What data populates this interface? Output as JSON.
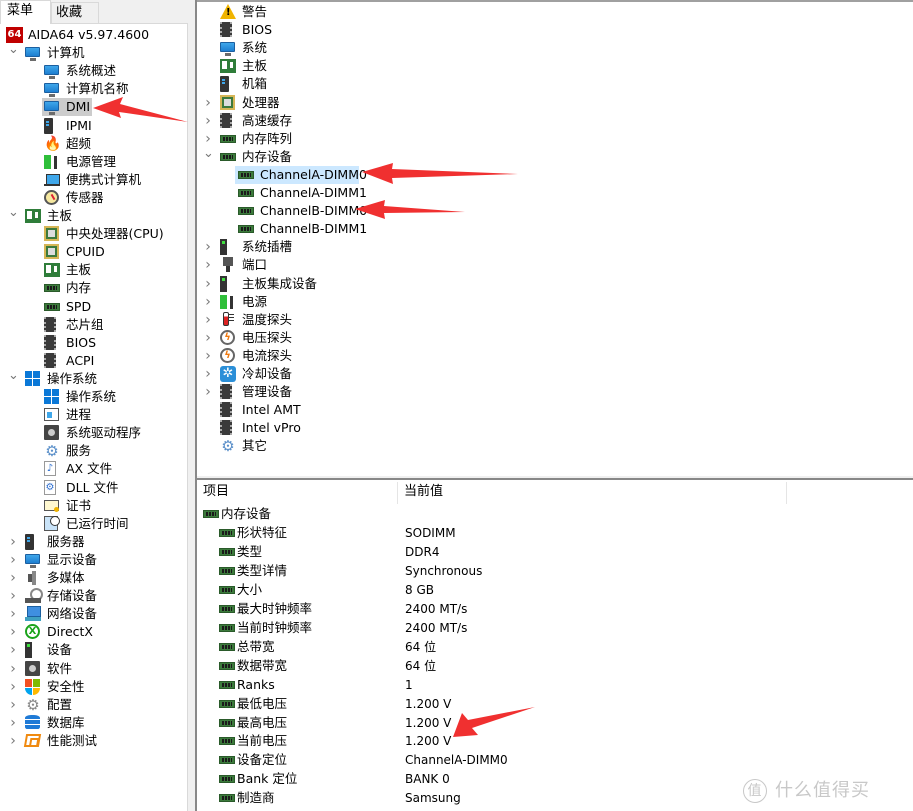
{
  "app": {
    "name": "AIDA64 v5.97.4600"
  },
  "left_panel": {
    "tabs": [
      {
        "label": "菜单",
        "active": true
      },
      {
        "label": "收藏夹",
        "active": false
      }
    ],
    "tree": [
      {
        "label": "AIDA64 v5.97.4600",
        "icon": "aida64-logo-icon",
        "level": 0,
        "chevron": ""
      },
      {
        "label": "计算机",
        "icon": "monitor-icon",
        "level": 1,
        "chevron": "expanded"
      },
      {
        "label": "系统概述",
        "icon": "monitor-icon",
        "level": 2,
        "chevron": ""
      },
      {
        "label": "计算机名称",
        "icon": "monitor-icon",
        "level": 2,
        "chevron": ""
      },
      {
        "label": "DMI",
        "icon": "monitor-icon",
        "level": 2,
        "chevron": "",
        "selected": true
      },
      {
        "label": "IPMI",
        "icon": "server-tower-icon",
        "level": 2,
        "chevron": ""
      },
      {
        "label": "超频",
        "icon": "flame-icon",
        "level": 2,
        "chevron": ""
      },
      {
        "label": "电源管理",
        "icon": "power-plug-icon",
        "level": 2,
        "chevron": ""
      },
      {
        "label": "便携式计算机",
        "icon": "laptop-icon",
        "level": 2,
        "chevron": ""
      },
      {
        "label": "传感器",
        "icon": "gauge-icon",
        "level": 2,
        "chevron": ""
      },
      {
        "label": "主板",
        "icon": "motherboard-icon",
        "level": 1,
        "chevron": "expanded"
      },
      {
        "label": "中央处理器(CPU)",
        "icon": "cpu-icon",
        "level": 2,
        "chevron": ""
      },
      {
        "label": "CPUID",
        "icon": "cpu-icon",
        "level": 2,
        "chevron": ""
      },
      {
        "label": "主板",
        "icon": "motherboard-icon",
        "level": 2,
        "chevron": ""
      },
      {
        "label": "内存",
        "icon": "ram-icon",
        "level": 2,
        "chevron": ""
      },
      {
        "label": "SPD",
        "icon": "ram-icon",
        "level": 2,
        "chevron": ""
      },
      {
        "label": "芯片组",
        "icon": "chip-icon",
        "level": 2,
        "chevron": ""
      },
      {
        "label": "BIOS",
        "icon": "chip-icon",
        "level": 2,
        "chevron": ""
      },
      {
        "label": "ACPI",
        "icon": "chip-icon",
        "level": 2,
        "chevron": ""
      },
      {
        "label": "操作系统",
        "icon": "windows-icon",
        "level": 1,
        "chevron": "expanded"
      },
      {
        "label": "操作系统",
        "icon": "windows-icon",
        "level": 2,
        "chevron": ""
      },
      {
        "label": "进程",
        "icon": "process-window-icon",
        "level": 2,
        "chevron": ""
      },
      {
        "label": "系统驱动程序",
        "icon": "driver-disk-icon",
        "level": 2,
        "chevron": ""
      },
      {
        "label": "服务",
        "icon": "gears-icon",
        "level": 2,
        "chevron": ""
      },
      {
        "label": "AX 文件",
        "icon": "music-file-icon",
        "level": 2,
        "chevron": ""
      },
      {
        "label": "DLL 文件",
        "icon": "dll-file-icon",
        "level": 2,
        "chevron": ""
      },
      {
        "label": "证书",
        "icon": "certificate-icon",
        "level": 2,
        "chevron": ""
      },
      {
        "label": "已运行时间",
        "icon": "uptime-clock-icon",
        "level": 2,
        "chevron": ""
      },
      {
        "label": "服务器",
        "icon": "server-tower-icon",
        "level": 1,
        "chevron": "collapsed"
      },
      {
        "label": "显示设备",
        "icon": "monitor-icon",
        "level": 1,
        "chevron": "collapsed"
      },
      {
        "label": "多媒体",
        "icon": "speaker-icon",
        "level": 1,
        "chevron": "collapsed"
      },
      {
        "label": "存储设备",
        "icon": "storage-drive-icon",
        "level": 1,
        "chevron": "collapsed"
      },
      {
        "label": "网络设备",
        "icon": "network-icon",
        "level": 1,
        "chevron": "collapsed"
      },
      {
        "label": "DirectX",
        "icon": "xbox-icon",
        "level": 1,
        "chevron": "collapsed"
      },
      {
        "label": "设备",
        "icon": "device-slot-icon",
        "level": 1,
        "chevron": "collapsed"
      },
      {
        "label": "软件",
        "icon": "driver-disk-icon",
        "level": 1,
        "chevron": "collapsed"
      },
      {
        "label": "安全性",
        "icon": "security-shield-icon",
        "level": 1,
        "chevron": "collapsed"
      },
      {
        "label": "配置",
        "icon": "config-gear-icon",
        "level": 1,
        "chevron": "collapsed"
      },
      {
        "label": "数据库",
        "icon": "database-icon",
        "level": 1,
        "chevron": "collapsed"
      },
      {
        "label": "性能测试",
        "icon": "benchmark-icon",
        "level": 1,
        "chevron": "collapsed"
      }
    ]
  },
  "right_tree": [
    {
      "label": "警告",
      "icon": "warning-icon",
      "level": 0,
      "chevron": ""
    },
    {
      "label": "BIOS",
      "icon": "chip-icon",
      "level": 0,
      "chevron": ""
    },
    {
      "label": "系统",
      "icon": "monitor-icon",
      "level": 0,
      "chevron": ""
    },
    {
      "label": "主板",
      "icon": "motherboard-icon",
      "level": 0,
      "chevron": ""
    },
    {
      "label": "机箱",
      "icon": "server-tower-icon",
      "level": 0,
      "chevron": ""
    },
    {
      "label": "处理器",
      "icon": "cpu-icon",
      "level": 0,
      "chevron": "collapsed"
    },
    {
      "label": "高速缓存",
      "icon": "chip-icon",
      "level": 0,
      "chevron": "collapsed"
    },
    {
      "label": "内存阵列",
      "icon": "ram-icon",
      "level": 0,
      "chevron": "collapsed"
    },
    {
      "label": "内存设备",
      "icon": "ram-icon",
      "level": 0,
      "chevron": "expanded"
    },
    {
      "label": "ChannelA-DIMM0",
      "icon": "ram-icon",
      "level": 1,
      "chevron": "",
      "selected": true
    },
    {
      "label": "ChannelA-DIMM1",
      "icon": "ram-icon",
      "level": 1,
      "chevron": ""
    },
    {
      "label": "ChannelB-DIMM0",
      "icon": "ram-icon",
      "level": 1,
      "chevron": ""
    },
    {
      "label": "ChannelB-DIMM1",
      "icon": "ram-icon",
      "level": 1,
      "chevron": ""
    },
    {
      "label": "系统插槽",
      "icon": "device-slot-icon",
      "level": 0,
      "chevron": "collapsed"
    },
    {
      "label": "端口",
      "icon": "port-icon",
      "level": 0,
      "chevron": "collapsed"
    },
    {
      "label": "主板集成设备",
      "icon": "device-slot-icon",
      "level": 0,
      "chevron": "collapsed"
    },
    {
      "label": "电源",
      "icon": "power-plug-icon",
      "level": 0,
      "chevron": "collapsed"
    },
    {
      "label": "温度探头",
      "icon": "thermometer-icon",
      "level": 0,
      "chevron": "collapsed"
    },
    {
      "label": "电压探头",
      "icon": "voltage-bolt-icon",
      "level": 0,
      "chevron": "collapsed"
    },
    {
      "label": "电流探头",
      "icon": "voltage-bolt-icon",
      "level": 0,
      "chevron": "collapsed"
    },
    {
      "label": "冷却设备",
      "icon": "fan-icon",
      "level": 0,
      "chevron": "collapsed"
    },
    {
      "label": "管理设备",
      "icon": "chip-icon",
      "level": 0,
      "chevron": "collapsed"
    },
    {
      "label": "Intel AMT",
      "icon": "chip-icon",
      "level": 0,
      "chevron": ""
    },
    {
      "label": "Intel vPro",
      "icon": "chip-icon",
      "level": 0,
      "chevron": ""
    },
    {
      "label": "其它",
      "icon": "gears-icon",
      "level": 0,
      "chevron": ""
    }
  ],
  "details": {
    "columns": [
      "项目",
      "当前值"
    ],
    "group": "内存设备",
    "rows": [
      {
        "field": "形状特征",
        "value": "SODIMM"
      },
      {
        "field": "类型",
        "value": "DDR4"
      },
      {
        "field": "类型详情",
        "value": "Synchronous"
      },
      {
        "field": "大小",
        "value": "8 GB"
      },
      {
        "field": "最大时钟频率",
        "value": "2400 MT/s"
      },
      {
        "field": "当前时钟频率",
        "value": "2400 MT/s"
      },
      {
        "field": "总带宽",
        "value": "64 位"
      },
      {
        "field": "数据带宽",
        "value": "64 位"
      },
      {
        "field": "Ranks",
        "value": "1"
      },
      {
        "field": "最低电压",
        "value": "1.200 V"
      },
      {
        "field": "最高电压",
        "value": "1.200 V"
      },
      {
        "field": "当前电压",
        "value": "1.200 V"
      },
      {
        "field": "设备定位",
        "value": "ChannelA-DIMM0"
      },
      {
        "field": "Bank 定位",
        "value": "BANK 0"
      },
      {
        "field": "制造商",
        "value": "Samsung"
      }
    ]
  },
  "annotations": {
    "arrow_color": "#f03030"
  },
  "watermark": {
    "logo": "值",
    "text": "什么值得买"
  }
}
